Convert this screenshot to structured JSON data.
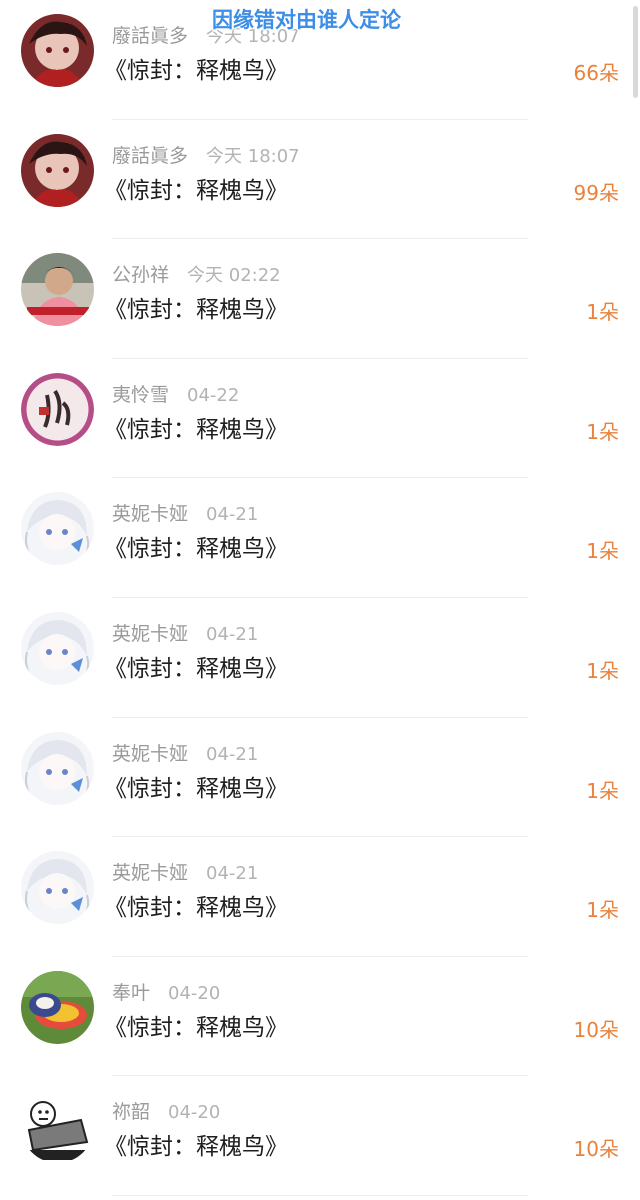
{
  "overlay_title": "因缘错对由谁人定论",
  "colors": {
    "accent": "#e8823c",
    "username": "#9a9a9a",
    "title_overlay": "#3d8ee6"
  },
  "rows": [
    {
      "avatar": "avatar-anime-red",
      "user": "廢話眞多",
      "time": "今天 18:07",
      "gift": "《惊封：释槐鸟》",
      "count": "66朵"
    },
    {
      "avatar": "avatar-anime-red",
      "user": "廢話眞多",
      "time": "今天 18:07",
      "gift": "《惊封：释槐鸟》",
      "count": "99朵"
    },
    {
      "avatar": "avatar-photo-person",
      "user": "公孙祥",
      "time": "今天 02:22",
      "gift": "《惊封：释槐鸟》",
      "count": "1朵"
    },
    {
      "avatar": "avatar-calligraphy",
      "user": "夷怜雪",
      "time": "04-22",
      "gift": "《惊封：释槐鸟》",
      "count": "1朵"
    },
    {
      "avatar": "avatar-anime-white",
      "user": "英妮卡娅",
      "time": "04-21",
      "gift": "《惊封：释槐鸟》",
      "count": "1朵"
    },
    {
      "avatar": "avatar-anime-white",
      "user": "英妮卡娅",
      "time": "04-21",
      "gift": "《惊封：释槐鸟》",
      "count": "1朵"
    },
    {
      "avatar": "avatar-anime-white",
      "user": "英妮卡娅",
      "time": "04-21",
      "gift": "《惊封：释槐鸟》",
      "count": "1朵"
    },
    {
      "avatar": "avatar-anime-white",
      "user": "英妮卡娅",
      "time": "04-21",
      "gift": "《惊封：释槐鸟》",
      "count": "1朵"
    },
    {
      "avatar": "avatar-colorful-hats",
      "user": "奉叶",
      "time": "04-20",
      "gift": "《惊封：释槐鸟》",
      "count": "10朵"
    },
    {
      "avatar": "avatar-meme-bed",
      "user": "祢韶",
      "time": "04-20",
      "gift": "《惊封：释槐鸟》",
      "count": "10朵"
    }
  ]
}
